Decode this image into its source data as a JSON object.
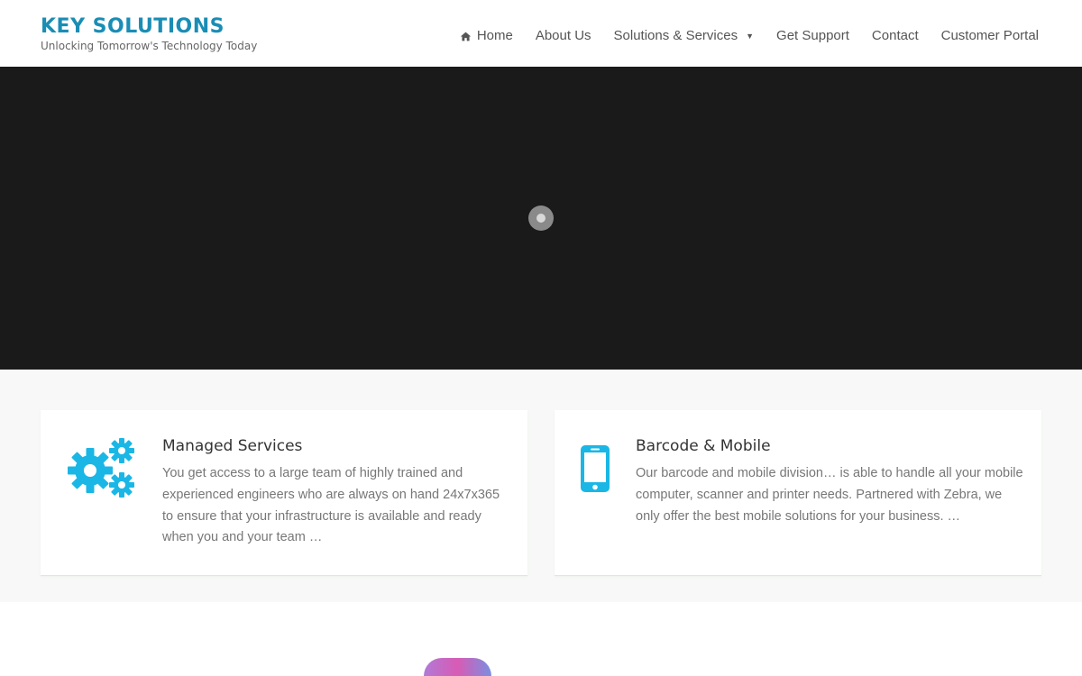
{
  "brand": {
    "title": "KEY SOLUTIONS",
    "tagline": "Unlocking Tomorrow's Technology Today",
    "color": "#1a8db5"
  },
  "nav": {
    "items": [
      {
        "label": "Home",
        "icon": "home-icon"
      },
      {
        "label": "About Us"
      },
      {
        "label": "Solutions & Services",
        "icon": "caret-down-icon"
      },
      {
        "label": "Get Support"
      },
      {
        "label": "Contact"
      },
      {
        "label": "Customer Portal"
      }
    ]
  },
  "hero": {
    "background": "#1a1a1a",
    "loader": "loading-spinner-icon"
  },
  "services": [
    {
      "title": "Managed Services",
      "icon": "gears-icon",
      "text": "You get access to a large team of highly trained and experienced engineers who are always on hand 24x7x365 to ensure that your infrastructure is available and ready when you and your team …"
    },
    {
      "title": "Barcode & Mobile",
      "icon": "mobile-phone-icon",
      "text": "Our barcode and mobile division… is able to handle all your mobile computer, scanner and printer needs. Partnered with Zebra, we only offer the best mobile solutions for your business. …"
    }
  ],
  "colors": {
    "accent": "#1ab7e6",
    "text": "#777777",
    "heading": "#333333"
  }
}
